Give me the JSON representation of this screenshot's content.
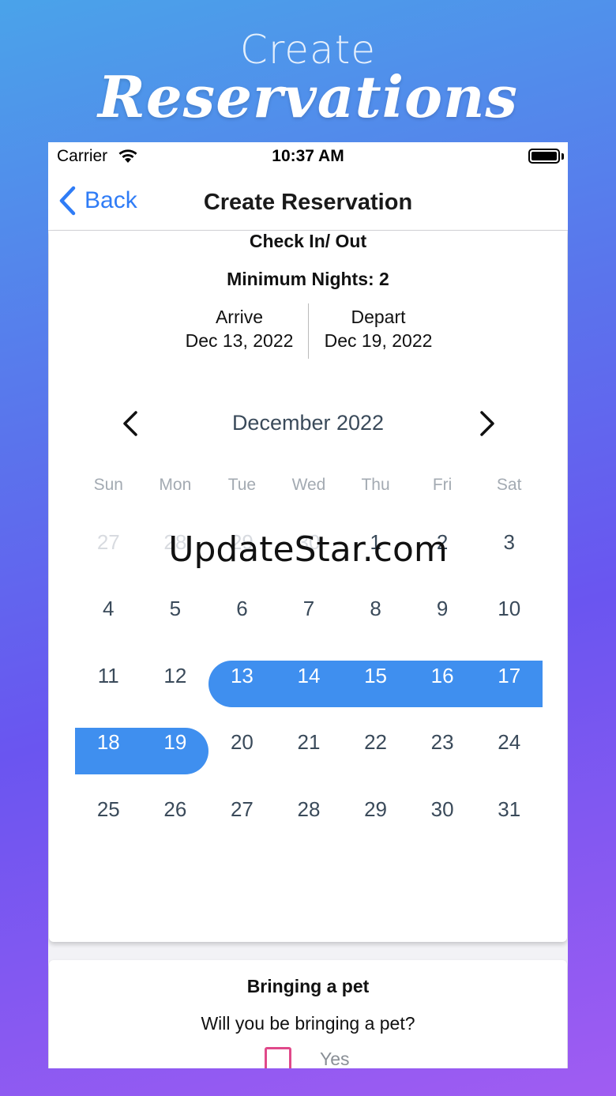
{
  "promo": {
    "line1": "Create",
    "line2": "Reservations"
  },
  "status_bar": {
    "carrier": "Carrier",
    "time": "10:37 AM"
  },
  "nav": {
    "back_label": "Back",
    "title": "Create Reservation"
  },
  "check": {
    "title": "Check In/ Out",
    "min_nights": "Minimum Nights: 2",
    "arrive_label": "Arrive",
    "arrive_date": "Dec 13, 2022",
    "depart_label": "Depart",
    "depart_date": "Dec 19, 2022"
  },
  "calendar": {
    "month": "December 2022",
    "weekdays": [
      "Sun",
      "Mon",
      "Tue",
      "Wed",
      "Thu",
      "Fri",
      "Sat"
    ],
    "weeks": [
      [
        {
          "d": "27",
          "m": true
        },
        {
          "d": "28",
          "m": true
        },
        {
          "d": "29",
          "m": true
        },
        {
          "d": "30",
          "m": true
        },
        {
          "d": "1"
        },
        {
          "d": "2"
        },
        {
          "d": "3"
        }
      ],
      [
        {
          "d": "4"
        },
        {
          "d": "5"
        },
        {
          "d": "6"
        },
        {
          "d": "7"
        },
        {
          "d": "8"
        },
        {
          "d": "9"
        },
        {
          "d": "10"
        }
      ],
      [
        {
          "d": "11"
        },
        {
          "d": "12"
        },
        {
          "d": "13",
          "s": true
        },
        {
          "d": "14",
          "s": true
        },
        {
          "d": "15",
          "s": true
        },
        {
          "d": "16",
          "s": true
        },
        {
          "d": "17",
          "s": true
        }
      ],
      [
        {
          "d": "18",
          "s": true
        },
        {
          "d": "19",
          "s": true
        },
        {
          "d": "20"
        },
        {
          "d": "21"
        },
        {
          "d": "22"
        },
        {
          "d": "23"
        },
        {
          "d": "24"
        }
      ],
      [
        {
          "d": "25"
        },
        {
          "d": "26"
        },
        {
          "d": "27"
        },
        {
          "d": "28"
        },
        {
          "d": "29"
        },
        {
          "d": "30"
        },
        {
          "d": "31"
        }
      ]
    ],
    "range_color": "#3f8fef"
  },
  "watermark": "UpdateStar.com",
  "pet": {
    "title": "Bringing a pet",
    "question": "Will you be bringing a pet?",
    "yes_label": "Yes",
    "checkbox_color": "#e0498a"
  },
  "accent_color": "#2f7cf6"
}
